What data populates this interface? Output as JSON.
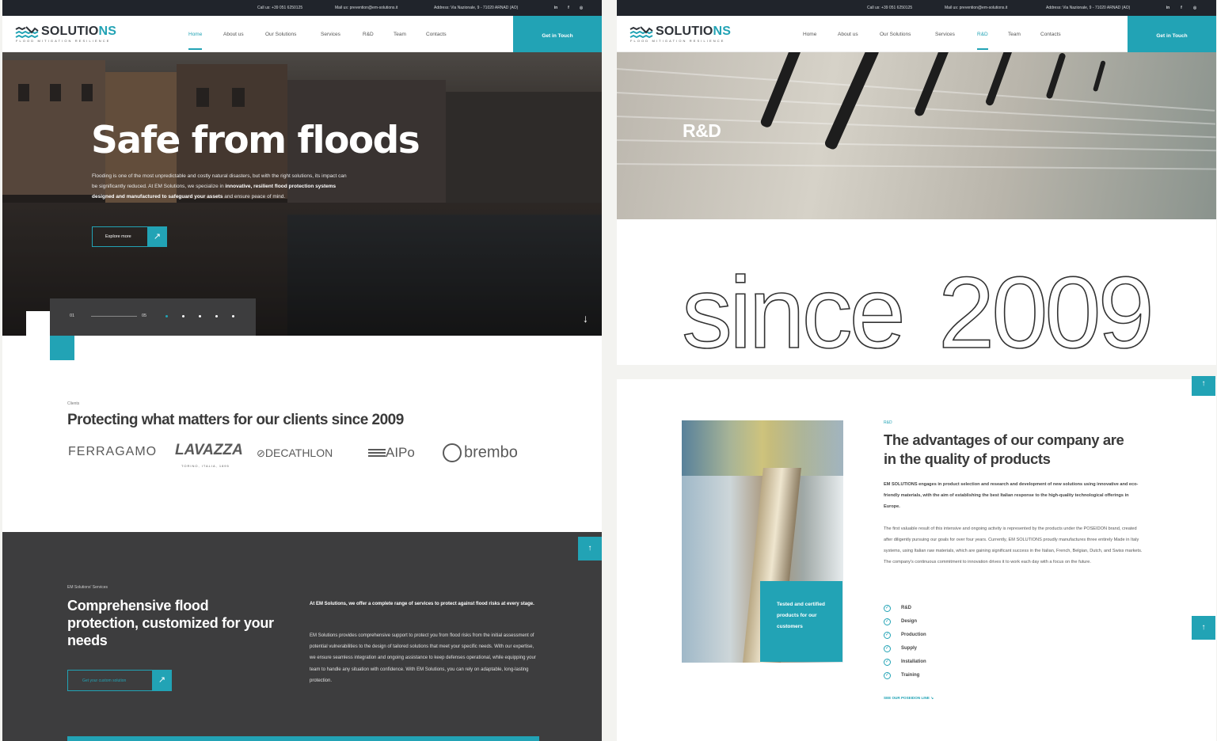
{
  "topbar": {
    "call": "Call us: +39 051 6250125",
    "mail": "Mail us: prevention@em-solutions.it",
    "address": "Address: Via Nazionale, 9 - 71020 ARNAD (AO)",
    "social": [
      "in",
      "f",
      "◎"
    ]
  },
  "logo": {
    "word_a": "SOLUTIO",
    "word_b": "NS",
    "tagline": "FLOOD MITIGATION RESILIENCE"
  },
  "nav": {
    "items": [
      "Home",
      "About us",
      "Our Solutions",
      "Services",
      "R&D",
      "Team",
      "Contacts"
    ],
    "cta": "Get in Touch"
  },
  "hero": {
    "title": "Safe from floods",
    "text_a": "Flooding is one of the most unpredictable and costly natural disasters, but with the right solutions, its impact can be significantly reduced. At EM Solutions, we specialize in ",
    "text_b": "innovative, resilient flood protection systems designed and manufactured to safeguard your assets",
    "text_c": " and ensure peace of mind.",
    "button": "Explore more",
    "slide_current": "01",
    "slide_total": "05"
  },
  "clients": {
    "kicker": "Clients",
    "title": "Protecting what matters for our clients since 2009",
    "brands": [
      "FERRAGAMO",
      "LAVAZZA",
      "DECATHLON",
      "AIPo",
      "brembo"
    ],
    "lavazza_sub": "TORINO, ITALIA, 1895"
  },
  "services": {
    "kicker": "EM Solutions' Services",
    "title": "Comprehensive flood protection, customized for your needs",
    "button": "Get your custom solution",
    "lead": "At EM Solutions, we offer a complete range of services to protect against flood risks at every stage.",
    "body": "EM Solutions provides comprehensive support to protect you from flood risks from the initial assessment of potential vulnerabilities to the design of tailored solutions that meet your specific needs. With our expertise, we ensure seamless integration and ongoing assistance to keep defenses operational, while equipping your team to handle any situation with confidence. With EM Solutions, you can rely on adaptable, long-lasting protection."
  },
  "rd_page": {
    "hero_title": "R&D",
    "since_word": "since",
    "since_year": "2009",
    "kicker": "R&D",
    "title": "The advantages of our company are in the quality of products",
    "p1": "EM SOLUTIONS engages in product selection and research and development of new solutions using innovative and eco-friendly materials, with the aim of establishing the best Italian response to the high-quality technological offerings in Europe.",
    "p2": "The first valuable result of this intensive and ongoing activity is represented by the products under the POSEIDON brand, created after diligently pursuing our goals for over four years. Currently, EM SOLUTIONS proudly manufactures three entirely Made in Italy systems, using Italian raw materials, which are gaining significant success in the Italian, French, Belgian, Dutch, and Swiss markets. The company's continuous commitment to innovation drives it to work each day with a focus on the future.",
    "photo_tag": "Tested and certified products for our customers",
    "features": [
      "R&D",
      "Design",
      "Production",
      "Supply",
      "Installation",
      "Training"
    ],
    "link": "SEE OUR POSEIDON LINE"
  },
  "colors": {
    "accent": "#22a3b5",
    "dark": "#3d3d3e",
    "topbar": "#20242b"
  }
}
